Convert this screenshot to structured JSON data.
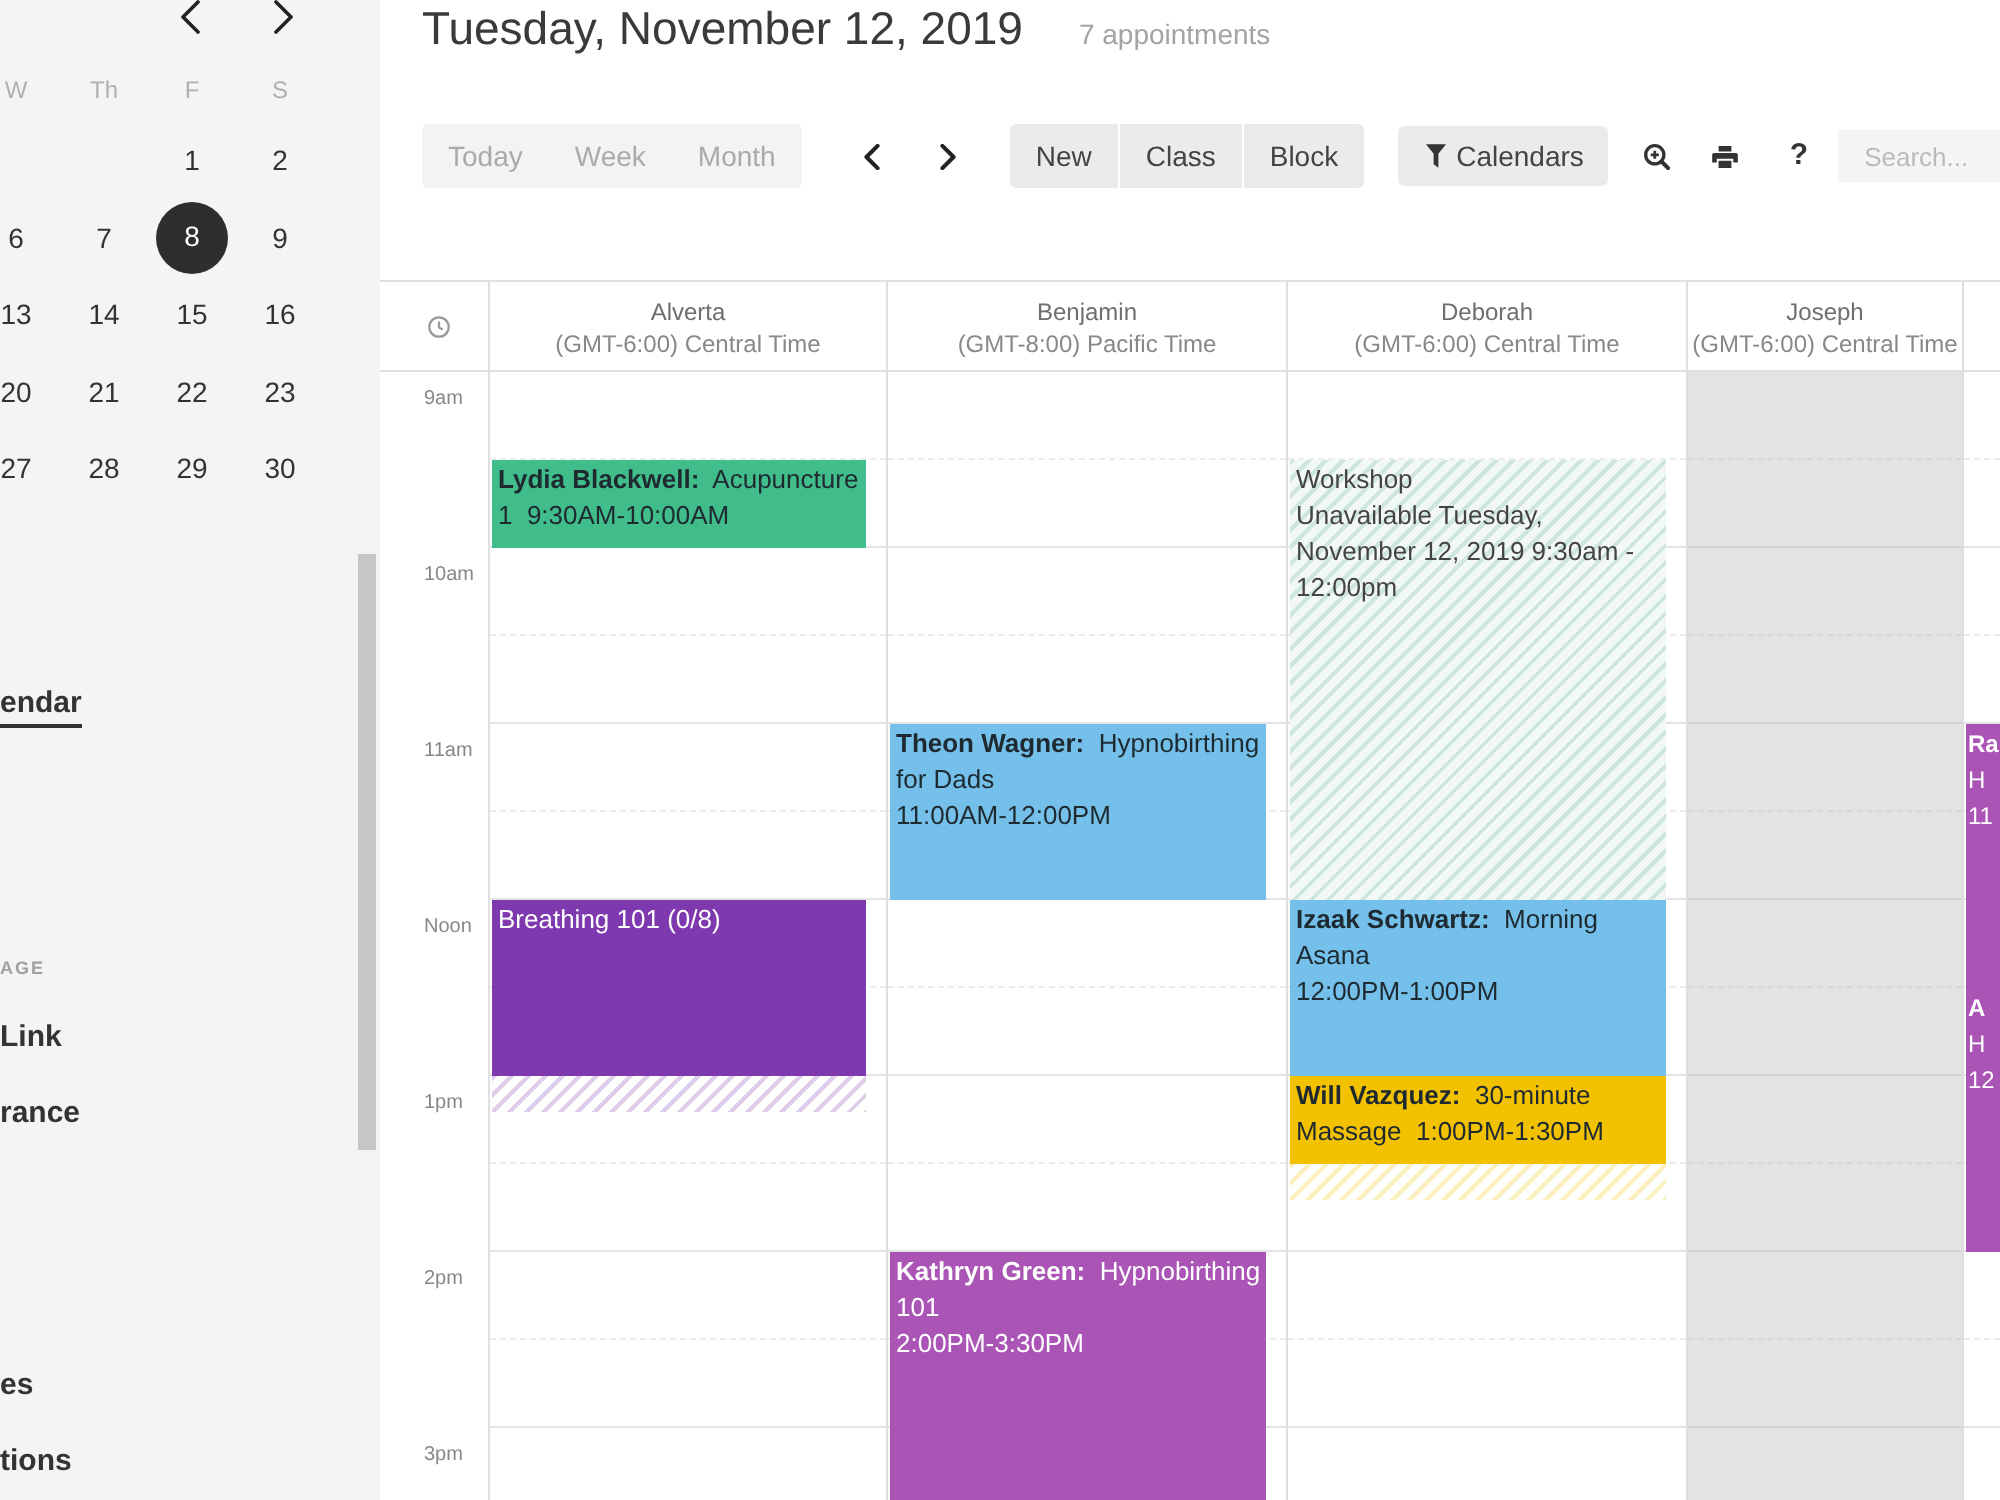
{
  "sidebar": {
    "mini_calendar": {
      "weekdays": [
        "W",
        "Th",
        "F",
        "S"
      ],
      "weeks": [
        [
          {
            "label": "1",
            "selected": false
          },
          {
            "label": "2",
            "selected": false
          }
        ],
        [
          {
            "label": "6",
            "selected": false
          },
          {
            "label": "7",
            "selected": false
          },
          {
            "label": "8",
            "selected": true
          },
          {
            "label": "9",
            "selected": false
          }
        ],
        [
          {
            "label": "13",
            "selected": false
          },
          {
            "label": "14",
            "selected": false
          },
          {
            "label": "15",
            "selected": false
          },
          {
            "label": "16",
            "selected": false
          }
        ],
        [
          {
            "label": "20",
            "selected": false
          },
          {
            "label": "21",
            "selected": false
          },
          {
            "label": "22",
            "selected": false
          },
          {
            "label": "23",
            "selected": false
          }
        ],
        [
          {
            "label": "27",
            "selected": false
          },
          {
            "label": "28",
            "selected": false
          },
          {
            "label": "29",
            "selected": false
          },
          {
            "label": "30",
            "selected": false
          }
        ]
      ]
    },
    "nav_groups": [
      {
        "items": [
          {
            "label": "endar",
            "selected": true
          }
        ]
      },
      {
        "heading": "AGE",
        "items": [
          {
            "label": "Link",
            "selected": false
          },
          {
            "label": "rance",
            "selected": false
          }
        ]
      },
      {
        "items": [
          {
            "label": "es",
            "selected": false
          },
          {
            "label": "tions",
            "selected": false
          }
        ]
      }
    ]
  },
  "header": {
    "title": "Tuesday, November 12, 2019",
    "count": "7 appointments"
  },
  "toolbar": {
    "views": [
      {
        "label": "Today"
      },
      {
        "label": "Week"
      },
      {
        "label": "Month"
      }
    ],
    "actions": [
      {
        "label": "New"
      },
      {
        "label": "Class"
      },
      {
        "label": "Block"
      }
    ],
    "filter": {
      "label": "Calendars"
    },
    "help": {
      "label": "?"
    },
    "search": {
      "placeholder": "Search..."
    }
  },
  "calendar": {
    "hours": [
      "9am",
      "10am",
      "11am",
      "Noon",
      "1pm",
      "2pm",
      "3pm"
    ],
    "columns": [
      {
        "name": "Alverta",
        "timezone": "(GMT-6:00) Central Time",
        "unavailable": false,
        "slots": [
          {
            "kind": "free"
          },
          {
            "kind": "appointment",
            "color": "#41bd8b",
            "lines": [
              "**Lydia Blackwell:**  Acupuncture 1  9:30AM-10:00AM"
            ]
          },
          {
            "kind": "free"
          },
          {
            "kind": "free"
          },
          {
            "kind": "free"
          },
          {
            "kind": "free"
          },
          {
            "kind": "class",
            "color": "#7f39ae",
            "buffer": true,
            "lines": [
              "Breathing 101 (0/8)"
            ]
          },
          {
            "kind": "continued"
          }
        ]
      },
      {
        "name": "Benjamin",
        "timezone": "(GMT-8:00) Pacific Time",
        "unavailable": false,
        "slots": [
          {
            "kind": "free"
          },
          {
            "kind": "free"
          },
          {
            "kind": "free"
          },
          {
            "kind": "free"
          },
          {
            "kind": "appointment",
            "color": "#74c0ea",
            "lines": [
              "**Theon Wagner:**  Hypnobirthing for Dads",
              "11:00AM-12:00PM"
            ]
          },
          {
            "kind": "continued"
          },
          {
            "kind": "free"
          },
          {
            "kind": "free"
          },
          {
            "kind": "free"
          },
          {
            "kind": "free"
          },
          {
            "kind": "appointment",
            "color": "#aa55b6",
            "lines": [
              "**Kathryn Green:**  Hypnobirthing 101",
              "2:00PM-3:30PM"
            ]
          },
          {
            "kind": "continued"
          },
          {
            "kind": "continued"
          }
        ]
      },
      {
        "name": "Deborah",
        "timezone": "(GMT-6:00) Central Time",
        "unavailable": false,
        "slots": [
          {
            "kind": "free"
          },
          {
            "kind": "block",
            "color": "#cfe6dc",
            "lines": [
              "Workshop",
              "Unavailable Tuesday, November 12, 2019 9:30am - 12:00pm"
            ]
          },
          {
            "kind": "continued"
          },
          {
            "kind": "continued"
          },
          {
            "kind": "continued"
          },
          {
            "kind": "continued"
          },
          {
            "kind": "appointment",
            "color": "#74c0ea",
            "lines": [
              "**Izaak Schwartz:**  Morning Asana",
              "12:00PM-1:00PM"
            ]
          },
          {
            "kind": "continued"
          },
          {
            "kind": "appointment",
            "color": "#f2c200",
            "buffer": true,
            "lines": [
              "**Will Vazquez:**  30-minute Massage  1:00PM-1:30PM"
            ]
          }
        ]
      },
      {
        "name": "Joseph",
        "timezone": "(GMT-6:00) Central Time",
        "unavailable": true
      },
      {
        "unavailable": false,
        "slots": [
          {
            "kind": "free"
          },
          {
            "kind": "free"
          },
          {
            "kind": "free"
          },
          {
            "kind": "free"
          },
          {
            "kind": "appointment",
            "color": "#aa55b6",
            "lines": [
              "**Ra**",
              "H",
              "11"
            ]
          },
          {
            "kind": "continued"
          },
          {
            "kind": "continued"
          },
          {
            "kind": "appointment",
            "color": "#aa55b6",
            "lines": [
              "**A**",
              "H",
              "12"
            ]
          },
          {
            "kind": "continued"
          },
          {
            "kind": "continued"
          }
        ]
      }
    ]
  }
}
